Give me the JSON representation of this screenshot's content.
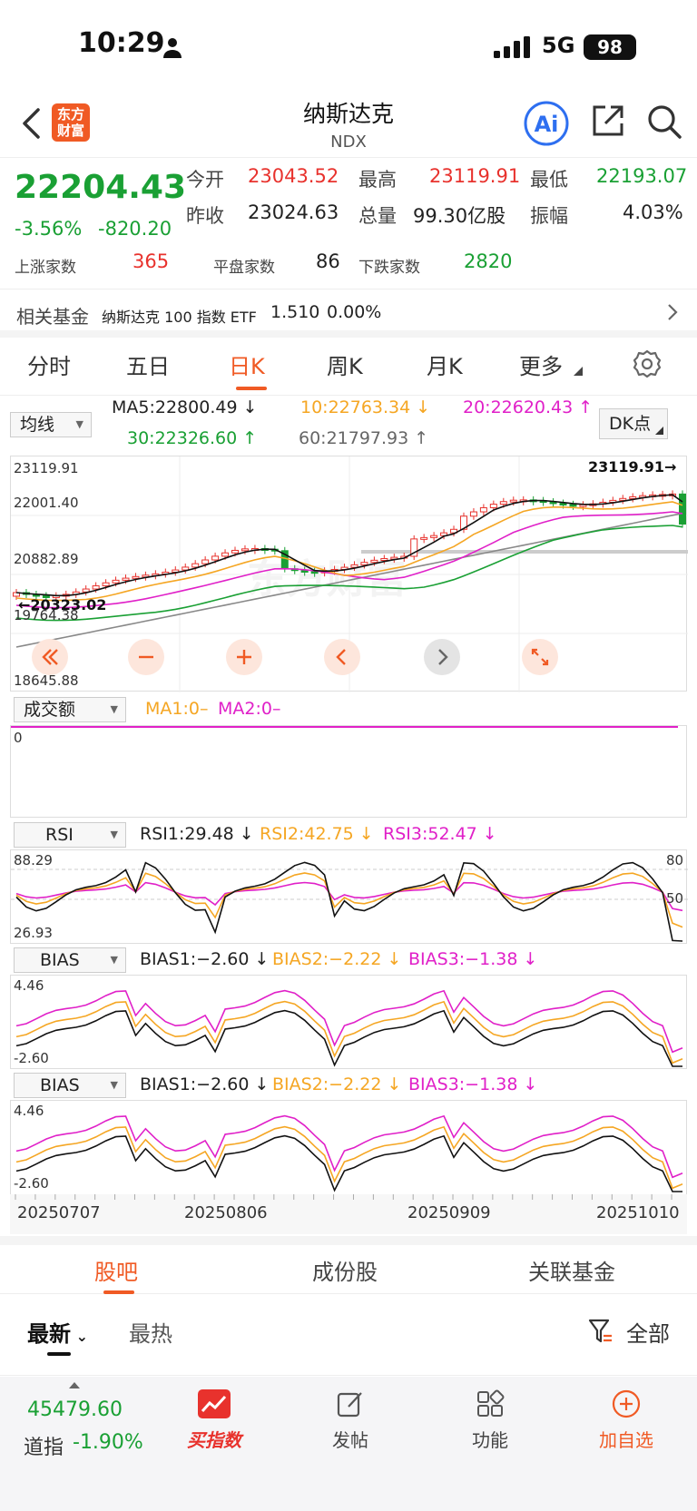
{
  "status": {
    "time": "10:29",
    "network": "5G",
    "battery": "98"
  },
  "header": {
    "logo": "东方财富",
    "title": "纳斯达克",
    "code": "NDX"
  },
  "quote": {
    "price": "22204.43",
    "change_pct": "-3.56%",
    "change": "-820.20",
    "open_label": "今开",
    "open": "23043.52",
    "high_label": "最高",
    "high": "23119.91",
    "low_label": "最低",
    "low": "22193.07",
    "prev_close_label": "昨收",
    "prev_close": "23024.63",
    "volume_label": "总量",
    "volume": "99.30亿股",
    "amplitude_label": "振幅",
    "amplitude": "4.03%",
    "up_label": "上涨家数",
    "up": "365",
    "flat_label": "平盘家数",
    "flat": "86",
    "down_label": "下跌家数",
    "down": "2820"
  },
  "fund": {
    "label": "相关基金",
    "name": "纳斯达克 100 指数 ETF",
    "price": "1.510",
    "pct": "0.00%"
  },
  "period_tabs": [
    "分时",
    "五日",
    "日K",
    "周K",
    "月K",
    "更多"
  ],
  "active_period": "日K",
  "indicator": {
    "main_select": "均线",
    "ma5": "MA5:22800.49 ↓",
    "ma10": "10:22763.34 ↓",
    "ma20": "20:22620.43 ↑",
    "ma30": "30:22326.60 ↑",
    "ma60": "60:21797.93 ↑",
    "dk_button": "DK点"
  },
  "kline_axis": [
    "23119.91",
    "22001.40",
    "20882.89",
    "19764.38",
    "18645.88"
  ],
  "kline_annotations": {
    "high": "23119.91",
    "low": "20323.02"
  },
  "volume_panel": {
    "select": "成交额",
    "ma1": "MA1:0–",
    "ma2": "MA2:0–",
    "axis": "0"
  },
  "rsi_panel": {
    "select": "RSI",
    "rsi1": "RSI1:29.48 ↓",
    "rsi2": "RSI2:42.75 ↓",
    "rsi3": "RSI3:52.47 ↓",
    "axis_top": "88.29",
    "axis_bottom": "26.93",
    "right_top": "80",
    "right_mid": "50"
  },
  "bias_panel": {
    "select": "BIAS",
    "bias1": "BIAS1:−2.60 ↓",
    "bias2": "BIAS2:−2.22 ↓",
    "bias3": "BIAS3:−1.38 ↓",
    "axis_top": "4.46",
    "axis_bottom": "-2.60"
  },
  "dates": [
    "20250707",
    "20250806",
    "20250909",
    "20251010"
  ],
  "bottom_tabs": [
    "股吧",
    "成份股",
    "关联基金"
  ],
  "sort": {
    "newest": "最新",
    "hottest": "最热",
    "filter": "全部"
  },
  "bottom_bar": {
    "index_value": "45479.60",
    "index_name": "道指",
    "index_pct": "-1.90%",
    "buy": "买指数",
    "post": "发帖",
    "function": "功能",
    "watch": "加自选"
  },
  "colors": {
    "up": "#e8322d",
    "down": "#1aa034",
    "accent": "#f05a24",
    "ma10": "#f5a623",
    "ma20": "#e020c8",
    "ma60": "#888888"
  }
}
